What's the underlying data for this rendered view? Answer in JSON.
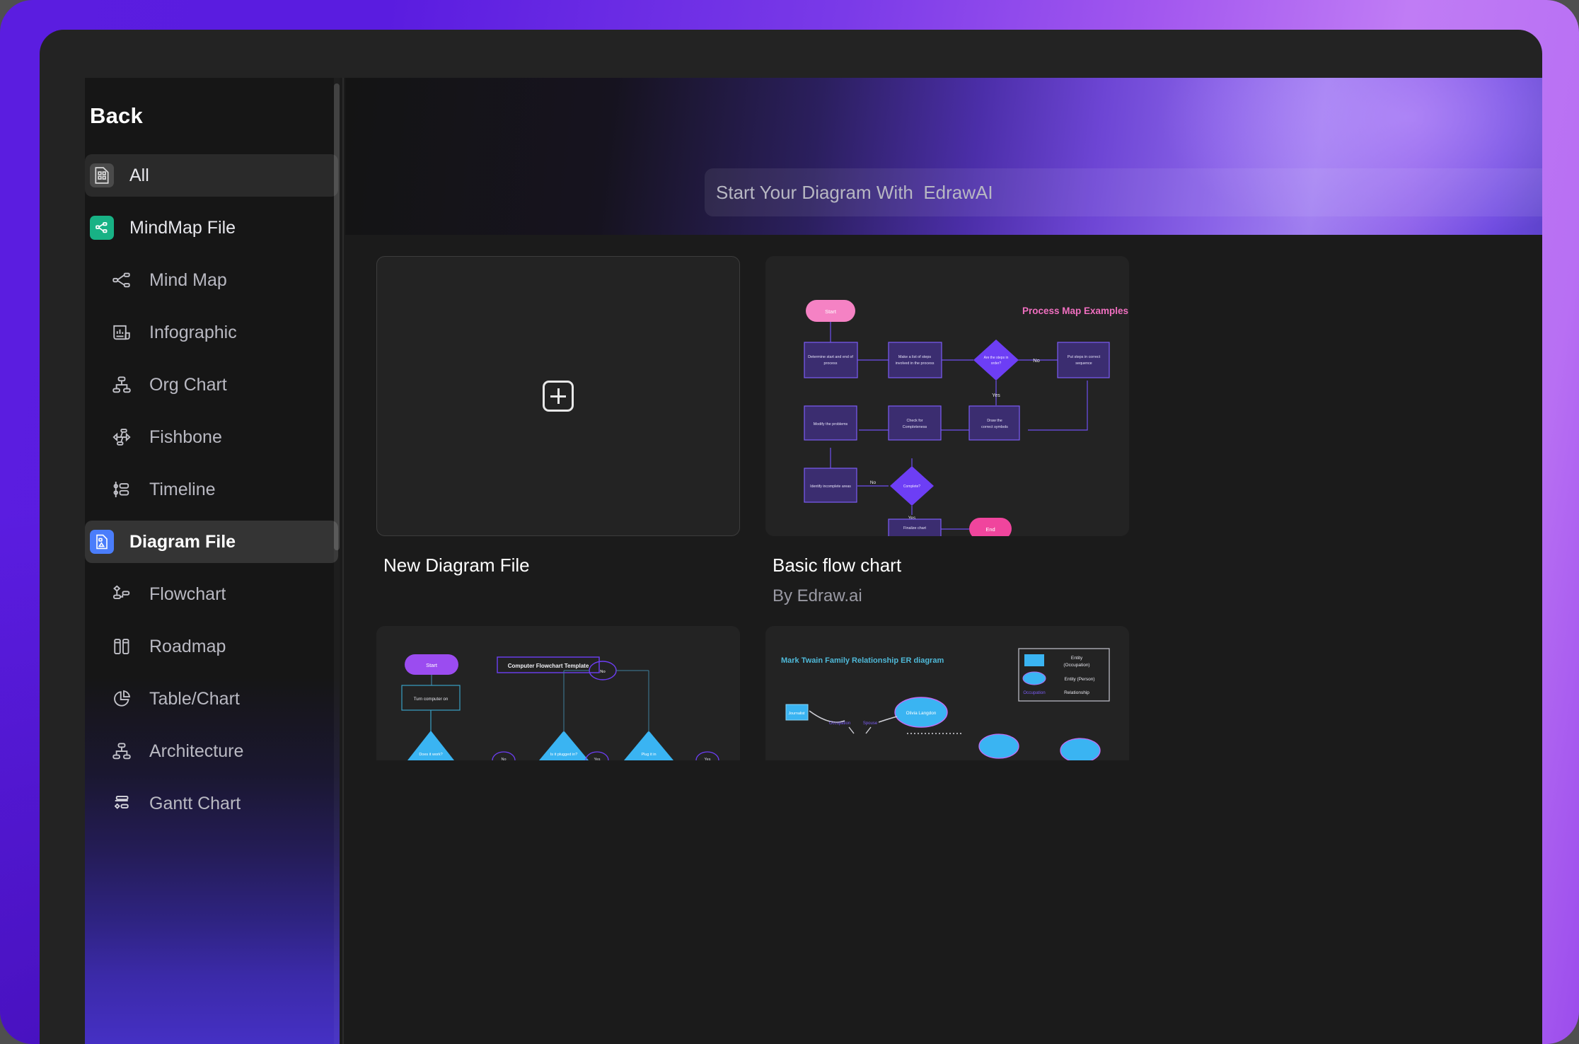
{
  "app": {
    "accent_purple": "#5b1de0",
    "accent_light_purple": "#c07cf5",
    "panel_bg": "#1b1b1b"
  },
  "sidebar": {
    "back_label": "Back",
    "scrollbar": true,
    "items": [
      {
        "label": "All",
        "icon": "grid-squares-file-icon",
        "type": "group",
        "active": false,
        "badge": "grey"
      },
      {
        "label": "MindMap File",
        "icon": "mindmap-file-icon",
        "type": "group",
        "active": false,
        "badge": "green"
      },
      {
        "label": "Mind Map",
        "icon": "mind-map-icon",
        "type": "child",
        "active": false
      },
      {
        "label": "Infographic",
        "icon": "infographic-icon",
        "type": "child",
        "active": false
      },
      {
        "label": "Org Chart",
        "icon": "org-chart-icon",
        "type": "child",
        "active": false
      },
      {
        "label": "Fishbone",
        "icon": "fishbone-icon",
        "type": "child",
        "active": false
      },
      {
        "label": "Timeline",
        "icon": "timeline-icon",
        "type": "child",
        "active": false
      },
      {
        "label": "Diagram File",
        "icon": "diagram-file-icon",
        "type": "group",
        "active": true,
        "badge": "blue"
      },
      {
        "label": "Flowchart",
        "icon": "flowchart-icon",
        "type": "child",
        "active": false
      },
      {
        "label": "Roadmap",
        "icon": "roadmap-icon",
        "type": "child",
        "active": false
      },
      {
        "label": "Table/Chart",
        "icon": "pie-chart-icon",
        "type": "child",
        "active": false
      },
      {
        "label": "Architecture",
        "icon": "architecture-icon",
        "type": "child",
        "active": false
      },
      {
        "label": "Gantt Chart",
        "icon": "gantt-chart-icon",
        "type": "child",
        "active": false
      }
    ]
  },
  "hero": {
    "ai_search_placeholder": "Start Your Diagram With  EdrawAI"
  },
  "cards": {
    "new_file": {
      "title": "New Diagram File",
      "icon": "plus-icon"
    },
    "basic_flow_chart": {
      "title": "Basic flow chart",
      "author": "By Edraw.ai",
      "thumbnail": {
        "heading": "Process Map Examples",
        "nodes": [
          {
            "id": "start",
            "text": "Start",
            "shape": "pill",
            "fill": "#f87ec0"
          },
          {
            "id": "n1",
            "text": "Determine start and end of process",
            "shape": "rect",
            "fill": "#3d2f73"
          },
          {
            "id": "n2",
            "text": "Make a list of steps involved in the process",
            "shape": "rect",
            "fill": "#3d2f73"
          },
          {
            "id": "d1",
            "text": "Are the steps in order?",
            "shape": "diamond",
            "fill": "#6d3ef5"
          },
          {
            "id": "n3",
            "text": "Put steps in correct sequence",
            "shape": "rect",
            "fill": "#3d2f73"
          },
          {
            "id": "n4",
            "text": "Draw the correct symbols",
            "shape": "rect",
            "fill": "#3d2f73"
          },
          {
            "id": "n5",
            "text": "Check for Completeness",
            "shape": "rect",
            "fill": "#3d2f73"
          },
          {
            "id": "n6",
            "text": "Modify the problems",
            "shape": "rect",
            "fill": "#3d2f73"
          },
          {
            "id": "n7",
            "text": "Identify incomplete areas",
            "shape": "rect",
            "fill": "#3d2f73"
          },
          {
            "id": "d2",
            "text": "Complete?",
            "shape": "diamond",
            "fill": "#6d3ef5"
          },
          {
            "id": "n8",
            "text": "Finalize chart",
            "shape": "rect",
            "fill": "#3d2f73"
          },
          {
            "id": "end",
            "text": "End",
            "shape": "pill",
            "fill": "#f24fa4"
          }
        ],
        "edge_labels": [
          "No",
          "Yes",
          "No",
          "Yes"
        ]
      }
    },
    "computer_flowchart": {
      "title": "Computer Flowchart Template",
      "thumbnail": {
        "heading": "Computer Flowchart Template",
        "nodes": [
          {
            "text": "Start",
            "shape": "pill",
            "fill": "#9b4cf0"
          },
          {
            "text": "Turn computer on",
            "shape": "rect",
            "fill": "transparent"
          },
          {
            "text": "Does it work?",
            "shape": "triangle",
            "fill": "#3ab4f2"
          },
          {
            "text": "Is it plugged in?",
            "shape": "triangle",
            "fill": "#3ab4f2"
          },
          {
            "text": "Plug it in",
            "shape": "triangle",
            "fill": "#3ab4f2"
          },
          {
            "text": "No",
            "shape": "circle",
            "fill": "transparent"
          },
          {
            "text": "Yes",
            "shape": "circle",
            "fill": "transparent"
          }
        ]
      }
    },
    "er_diagram": {
      "title": "Mark Twain Family Relationship ER diagram",
      "thumbnail": {
        "heading": "Mark Twain Family Relationship ER diagram",
        "entities": [
          {
            "text": "Journalist",
            "shape": "rect",
            "fill": "#3ab4f2"
          },
          {
            "text": "Olivia Langdon",
            "shape": "ellipse",
            "fill": "#3ab4f2"
          }
        ],
        "relationships": [
          "Occupation",
          "Spouse"
        ],
        "legend": [
          {
            "swatch": "rect",
            "label": "Entity (Occupation)"
          },
          {
            "swatch": "ellipse",
            "label": "Entity (Person)"
          },
          {
            "swatch": "text",
            "label": "Relationship",
            "text": "Occupation"
          }
        ]
      }
    }
  }
}
